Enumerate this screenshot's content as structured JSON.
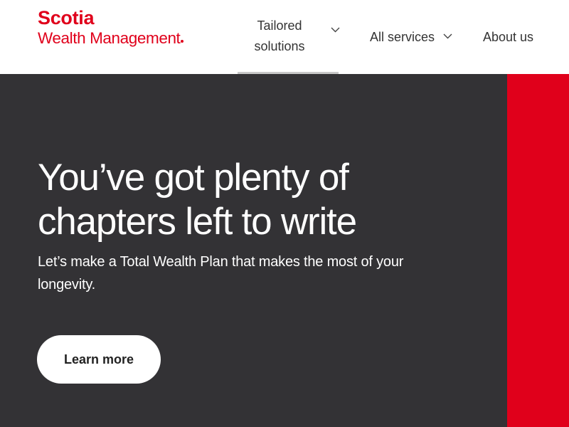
{
  "header": {
    "logo": {
      "brand": "Scotia",
      "subline": "Wealth Management",
      "color": "#e0001b"
    },
    "nav": {
      "tailored": {
        "label": "Tailored solutions",
        "icon": "chevron-down-icon",
        "active": true
      },
      "services": {
        "label": "All services",
        "icon": "chevron-down-icon"
      },
      "about": {
        "label": "About us"
      }
    }
  },
  "hero": {
    "title": "You’ve got plenty of chapters left to write",
    "subtitle": "Let’s make a Total Wealth Plan that makes the most of your longevity.",
    "cta_label": "Learn more",
    "background_color": "#333235",
    "accent_panel_color": "#e0001b"
  }
}
